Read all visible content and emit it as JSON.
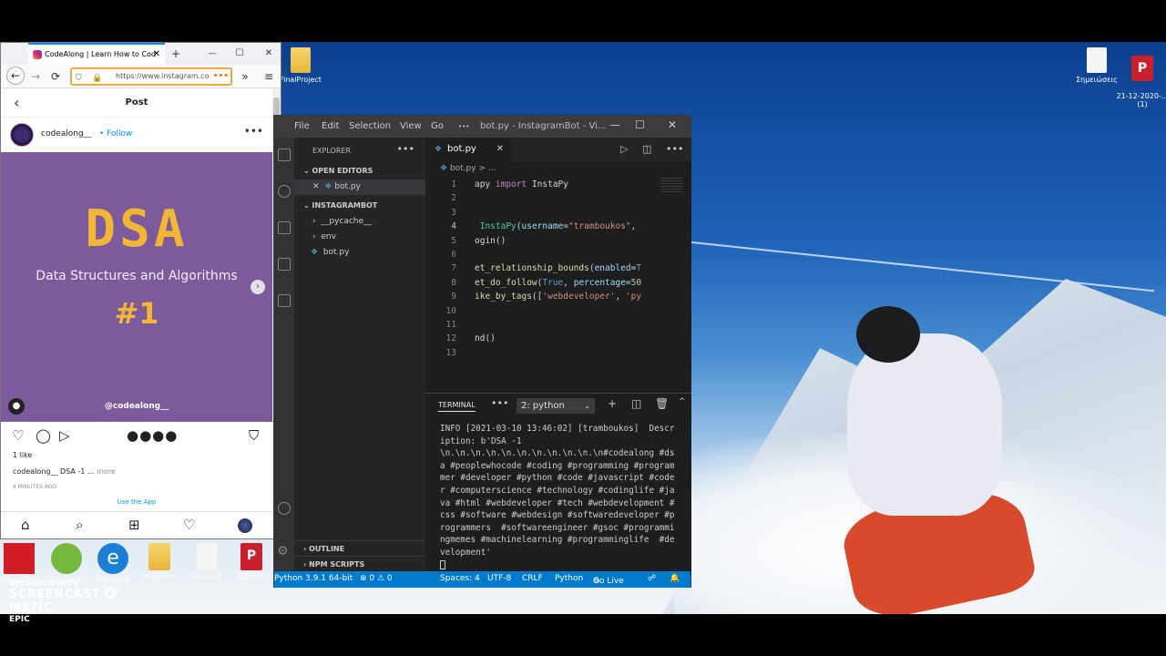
{
  "desktop": {
    "top_icons": [
      {
        "label": "FinalProject",
        "type": "folder"
      },
      {
        "label": "Σημειώσεις",
        "type": "doc"
      },
      {
        "label": "21-12-2020-...\n(1)",
        "type": "pdf"
      }
    ],
    "bottom_icons": [
      {
        "label": "MarvellTray",
        "type": "app"
      },
      {
        "label": "uTorrent",
        "type": "app"
      },
      {
        "label": "Microsoft Edge",
        "type": "edge"
      },
      {
        "label": "milkplan",
        "type": "folder"
      },
      {
        "label": "ass.psd",
        "type": "doc"
      },
      {
        "label": "ΟΔΗΓΙΕ",
        "type": "pdf"
      }
    ],
    "watermark": {
      "recorded_with": "RECORDED WITH",
      "brand": "SCREENCAST",
      "brand_suffix": "MATIC",
      "extra": "EPIC"
    }
  },
  "browser": {
    "tab_title": "CodeAlong | Learn How to Cod",
    "url": "https://www.instagram.co",
    "url_more": "•••",
    "icons": {
      "back": "←",
      "forward": "→",
      "reload": "⟳",
      "overflow": "»",
      "menu": "≡",
      "new_tab": "+",
      "minimize": "—",
      "maximize": "☐",
      "close": "✕"
    },
    "page": {
      "header_title": "Post",
      "username": "codealong__",
      "follow_label": "Follow",
      "post_image": {
        "headline": "DSA",
        "subtitle": "Data Structures and Algorithms",
        "number": "#1",
        "handle": "@codealong__"
      },
      "likes": "1 like",
      "caption_user": "codealong__",
      "caption_text": "DSA -1 ...",
      "caption_more": "more",
      "time_ago": "4 MINUTES AGO",
      "see_app": "Use the App"
    }
  },
  "vscode": {
    "menu": [
      "File",
      "Edit",
      "Selection",
      "View",
      "Go",
      "•••"
    ],
    "window_title": "bot.py - InstagramBot - Vi...",
    "explorer_label": "EXPLORER",
    "open_editors_label": "OPEN EDITORS",
    "open_editor_file": "bot.py",
    "project_label": "INSTAGRAMBOT",
    "tree": [
      {
        "label": "__pycache__",
        "kind": "folder"
      },
      {
        "label": "env",
        "kind": "folder"
      },
      {
        "label": "bot.py",
        "kind": "file"
      }
    ],
    "outline_label": "OUTLINE",
    "npm_label": "NPM SCRIPTS",
    "active_tab": "bot.py",
    "breadcrumb": "bot.py > ...",
    "code_lines": [
      {
        "n": "1",
        "html": "<span class='src'>apy <span class='kw'>import</span> InstaPy</span>"
      },
      {
        "n": "2",
        "html": ""
      },
      {
        "n": "3",
        "html": ""
      },
      {
        "n": "4",
        "html": "<span class='src'> <span class='cls'>InstaPy</span>(<span class='var'>username</span>=<span class='str'>\"tramboukos\"</span>,</span>"
      },
      {
        "n": "5",
        "html": "<span class='src'>ogin()</span>"
      },
      {
        "n": "6",
        "html": ""
      },
      {
        "n": "7",
        "html": "<span class='src'><span class='fn'>et_relationship_bounds</span>(<span class='var'>enabled</span>=<span class='bool'>T</span></span>"
      },
      {
        "n": "8",
        "html": "<span class='src'><span class='fn'>et_do_follow</span>(<span class='bool'>True</span>, <span class='var'>percentage</span>=<span class='num'>50</span></span>"
      },
      {
        "n": "9",
        "html": "<span class='src'><span class='fn'>ike_by_tags</span>([<span class='str'>'webdeveloper'</span>, <span class='str'>'py</span></span>"
      },
      {
        "n": "10",
        "html": ""
      },
      {
        "n": "11",
        "html": ""
      },
      {
        "n": "12",
        "html": "<span class='src'><span class='fn'>nd</span>()</span>"
      },
      {
        "n": "13",
        "html": ""
      }
    ],
    "current_line": "4",
    "terminal_label": "TERMINAL",
    "terminal_select": "2: python",
    "terminal_output": "INFO [2021-03-10 13:46:02] [tramboukos]  Description: b'DSA -1 \\n.\\n.\\n.\\n.\\n.\\n.\\n.\\n.\\n.\\n.\\n#codealong #dsa #peoplewhocode #coding #programming #programmer #developer #python #code #javascript #coder #computerscience #technology #codinglife #java #html #webdeveloper #tech #webdevelopment #css #software #webdesign #softwaredeveloper #programmers  #softwareengineer #gsoc #programmingmemes #machinelearning #programminglife  #development'",
    "status": {
      "python": "Python 3.9.1 64-bit",
      "problems": "⊗ 0 ⚠ 0",
      "spaces": "Spaces: 4",
      "encoding": "UTF-8",
      "eol": "CRLF",
      "language": "Python",
      "golive": "Go Live"
    }
  }
}
